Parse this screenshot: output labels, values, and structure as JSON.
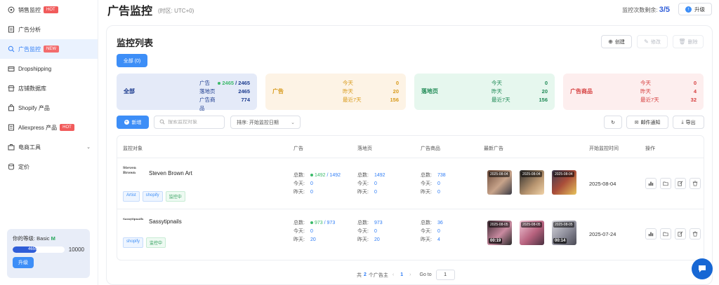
{
  "sidebar": {
    "items": [
      {
        "label": "销售监控",
        "badge": "HOT"
      },
      {
        "label": "广告分析",
        "badge": ""
      },
      {
        "label": "广告监控",
        "badge": "NEW"
      },
      {
        "label": "Dropshipping",
        "badge": ""
      },
      {
        "label": "店铺数据库",
        "badge": ""
      },
      {
        "label": "Shopify 产品",
        "badge": ""
      },
      {
        "label": "Aliexpress 产品",
        "badge": "HOT"
      },
      {
        "label": "电商工具",
        "badge": ""
      },
      {
        "label": "定价",
        "badge": ""
      }
    ],
    "level": {
      "label": "你的等级: Basic",
      "tier": "M",
      "current": "4659",
      "max": "10000",
      "progress": 0.466,
      "upgrade_label": "升级"
    }
  },
  "header": {
    "title": "广告监控",
    "timezone": "(时区: UTC+0)",
    "remain_label": "监控次数剩余:",
    "remain_value": "3/5",
    "upgrade_label": "升级"
  },
  "panel": {
    "title": "监控列表",
    "create_label": "创建",
    "edit_label": "修改",
    "delete_label": "删除",
    "tab_all": "全部 (0)"
  },
  "cards": {
    "all": {
      "title": "全部",
      "ad_label": "广告",
      "ad_active": "2465",
      "ad_total": "/ 2465",
      "landing_label": "落地页",
      "landing_value": "2465",
      "product_label": "广告商品",
      "product_value": "774"
    },
    "ads": {
      "title": "广告",
      "today_label": "今天",
      "today": "0",
      "yesterday_label": "昨天",
      "yesterday": "20",
      "week_label": "最近7天",
      "week": "156"
    },
    "landing": {
      "title": "落地页",
      "today_label": "今天",
      "today": "0",
      "yesterday_label": "昨天",
      "yesterday": "20",
      "week_label": "最近7天",
      "week": "156"
    },
    "products": {
      "title": "广告商品",
      "today_label": "今天",
      "today": "0",
      "yesterday_label": "昨天",
      "yesterday": "4",
      "week_label": "最近7天",
      "week": "32"
    }
  },
  "toolbar": {
    "new_label": "新增",
    "search_placeholder": "搜索监控对象",
    "sort_label": "排序: 开始监控日期",
    "email_label": "邮件通知",
    "export_label": "导出"
  },
  "table": {
    "headers": [
      "监控对象",
      "广告",
      "落地页",
      "广告商品",
      "最新广告",
      "开始监控时间",
      "操作"
    ],
    "rows": [
      {
        "logo": "Steven Brown",
        "name": "Steven Brown Art",
        "tags": [
          "Artist",
          "shopify",
          "监控中"
        ],
        "ads": {
          "total_label": "总数:",
          "active": "1492",
          "total": "/ 1492",
          "today_label": "今天:",
          "today": "0",
          "yesterday_label": "昨天:",
          "yesterday": "0"
        },
        "landing": {
          "total_label": "总数:",
          "total": "1492",
          "today_label": "今天:",
          "today": "0",
          "yesterday_label": "昨天:",
          "yesterday": "0"
        },
        "products": {
          "total_label": "总数:",
          "total": "738",
          "today_label": "今天:",
          "today": "0",
          "yesterday_label": "昨天:",
          "yesterday": "0"
        },
        "thumbs": [
          {
            "date": "2025-08-04",
            "dur": ""
          },
          {
            "date": "2025-08-04",
            "dur": ""
          },
          {
            "date": "2025-08-04",
            "dur": ""
          }
        ],
        "start": "2025-08-04"
      },
      {
        "logo": "Sassytipnails",
        "name": "Sassytipnails",
        "tags": [
          "shopify",
          "监控中"
        ],
        "ads": {
          "total_label": "总数:",
          "active": "973",
          "total": "/ 973",
          "today_label": "今天:",
          "today": "0",
          "yesterday_label": "昨天:",
          "yesterday": "20"
        },
        "landing": {
          "total_label": "总数:",
          "total": "973",
          "today_label": "今天:",
          "today": "0",
          "yesterday_label": "昨天:",
          "yesterday": "20"
        },
        "products": {
          "total_label": "总数:",
          "total": "36",
          "today_label": "今天:",
          "today": "0",
          "yesterday_label": "昨天:",
          "yesterday": "4"
        },
        "thumbs": [
          {
            "date": "2025-08-05",
            "dur": "00:19"
          },
          {
            "date": "2025-08-05",
            "dur": ""
          },
          {
            "date": "2025-08-05",
            "dur": "00:14"
          }
        ],
        "start": "2025-07-24"
      }
    ]
  },
  "pager": {
    "prefix": "共",
    "count": "2",
    "suffix": "个广告主",
    "page": "1",
    "goto_label": "Go to",
    "goto_value": "1"
  },
  "colors": {
    "accent": "#3d8ef7",
    "deep": "#2f5dd8"
  }
}
